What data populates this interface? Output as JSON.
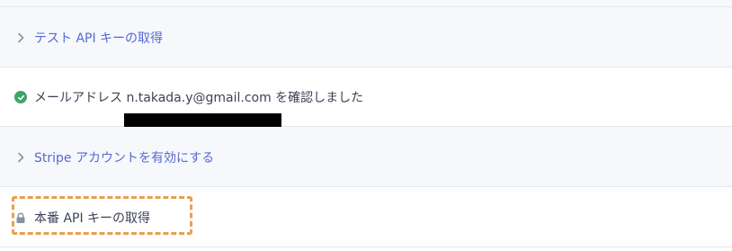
{
  "steps": [
    {
      "label": "テスト API キーの取得",
      "icon": "chevron-right-icon"
    },
    {
      "label": "メールアドレス n.takada.y@gmail.com を確認しました",
      "icon": "check-circle-icon"
    },
    {
      "label": "Stripe アカウントを有効にする",
      "icon": "chevron-right-icon"
    },
    {
      "label": "本番 API キーの取得",
      "icon": "lock-icon"
    }
  ],
  "colors": {
    "link": "#5469d4",
    "text": "#3c4257",
    "success": "#3ea56a",
    "highlight": "#e8a050",
    "redaction": "#000000"
  }
}
